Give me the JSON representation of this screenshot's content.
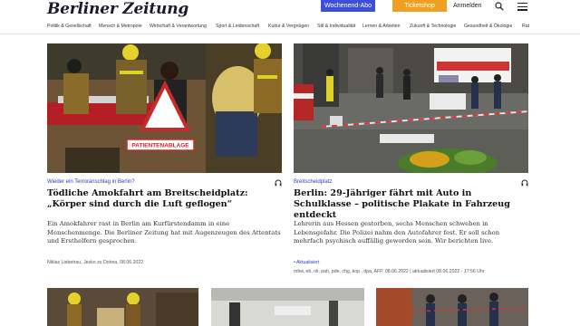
{
  "header": {
    "logo": "Berliner Zeitung",
    "abo_label": "Wochenend-Abo",
    "ticket_label": "Ticketshop",
    "login_label": "Anmelden"
  },
  "nav": {
    "items": [
      "Politik & Gesellschaft",
      "Mensch & Metropole",
      "Wirtschaft & Verantwortung",
      "Sport & Leidenschaft",
      "Kultur & Vergnügen",
      "Stil & Individualität",
      "Lernen & Arbeiten",
      "Zukunft & Technologie",
      "Gesundheit & Ökologie",
      "Rat"
    ]
  },
  "articles": [
    {
      "kicker": "Wieder ein Terroranschlag in Berlin?",
      "headline": "Tödliche Amokfahrt am Breitscheidplatz: „Körper sind durch die Luft geflogen“",
      "teaser": "Ein Amokfahrer rast in Berlin am Kurfürstendamm in eine Menschenmenge. Die Berliner Zeitung hat mit Augenzeugen des Attentats und Ersthelfern gesprochen.",
      "meta": "Niklas Liebetrau, Jesko zu Dohna, 08.06.2022",
      "image_caption": "PATIENTENABLAGE"
    },
    {
      "kicker": "Breitscheidplatz",
      "headline": "Berlin: 29-Jähriger fährt mit Auto in Schulklasse – politische Plakate in Fahrzeug entdeckt",
      "teaser": "Lehrerin aus Hessen gestorben, sechs Menschen schweben in Lebensgefahr. Die Polizei nahm den Autofahrer fest. Er soll schon mehrfach psychisch auffällig geworden sein. Wir berichten live.",
      "updated_label": "• Aktualisiert",
      "meta": "mbw, eb, nli, pah, pde, chg, kop., dpa, AFP, 08.06.2022 | aktualisiert 08.06.2022 - 17:56 Uhr"
    }
  ]
}
